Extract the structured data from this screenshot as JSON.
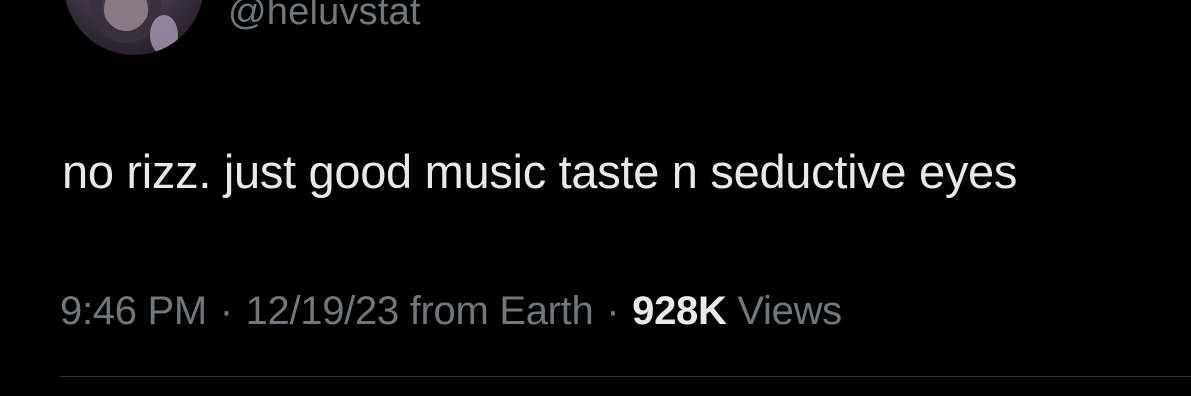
{
  "tweet": {
    "handle": "@heluvstat",
    "text": "no rizz. just good music taste n seductive eyes",
    "time": "9:46 PM",
    "separator": "·",
    "date": "12/19/23",
    "location": "from Earth",
    "views_count": "928K",
    "views_label": "Views"
  },
  "icons": {
    "avatar": "profile-photo"
  },
  "colors": {
    "background": "#000000",
    "text_primary": "#e7e9ea",
    "text_secondary": "#71767b",
    "divider": "#2f3336"
  }
}
